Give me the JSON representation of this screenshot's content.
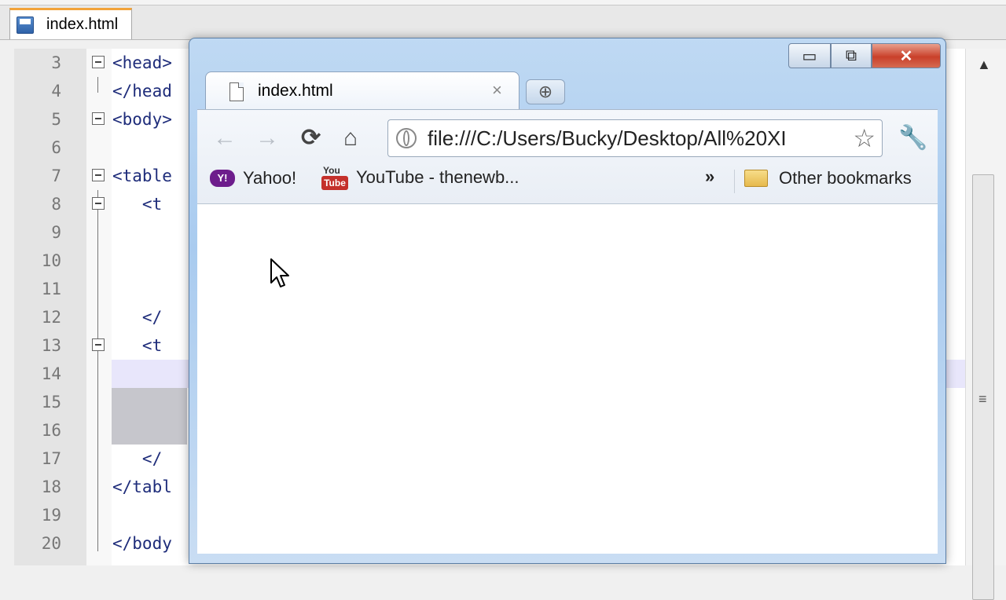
{
  "editor": {
    "tab_label": "index.html",
    "lines": [
      {
        "num": "3",
        "text": "<head>"
      },
      {
        "num": "4",
        "text": "</head"
      },
      {
        "num": "5",
        "text": "<body>"
      },
      {
        "num": "6",
        "text": ""
      },
      {
        "num": "7",
        "text": "<table"
      },
      {
        "num": "8",
        "text": "   <t"
      },
      {
        "num": "9",
        "text": ""
      },
      {
        "num": "10",
        "text": ""
      },
      {
        "num": "11",
        "text": ""
      },
      {
        "num": "12",
        "text": "   </"
      },
      {
        "num": "13",
        "text": "   <t"
      },
      {
        "num": "14",
        "text": ""
      },
      {
        "num": "15",
        "text": ""
      },
      {
        "num": "16",
        "text": ""
      },
      {
        "num": "17",
        "text": "   </"
      },
      {
        "num": "18",
        "text": "</tabl"
      },
      {
        "num": "19",
        "text": ""
      },
      {
        "num": "20",
        "text": "</body"
      }
    ]
  },
  "browser": {
    "tab_title": "index.html",
    "tab_close": "×",
    "new_tab": "⊕",
    "url": "file:///C:/Users/Bucky/Desktop/All%20XI",
    "window_controls": {
      "minimize": "▭",
      "maximize": "⧉",
      "close": "✕"
    },
    "nav": {
      "back": "←",
      "forward": "→",
      "reload": "⟳",
      "home": "⌂",
      "star": "☆",
      "wrench": "🔧"
    },
    "bookmarks": {
      "yahoo_icon": "Y!",
      "yahoo": "Yahoo!",
      "youtube_icon_top": "You",
      "youtube_icon_bottom": "Tube",
      "youtube": "YouTube - thenewb...",
      "overflow": "»",
      "other": "Other bookmarks"
    }
  }
}
